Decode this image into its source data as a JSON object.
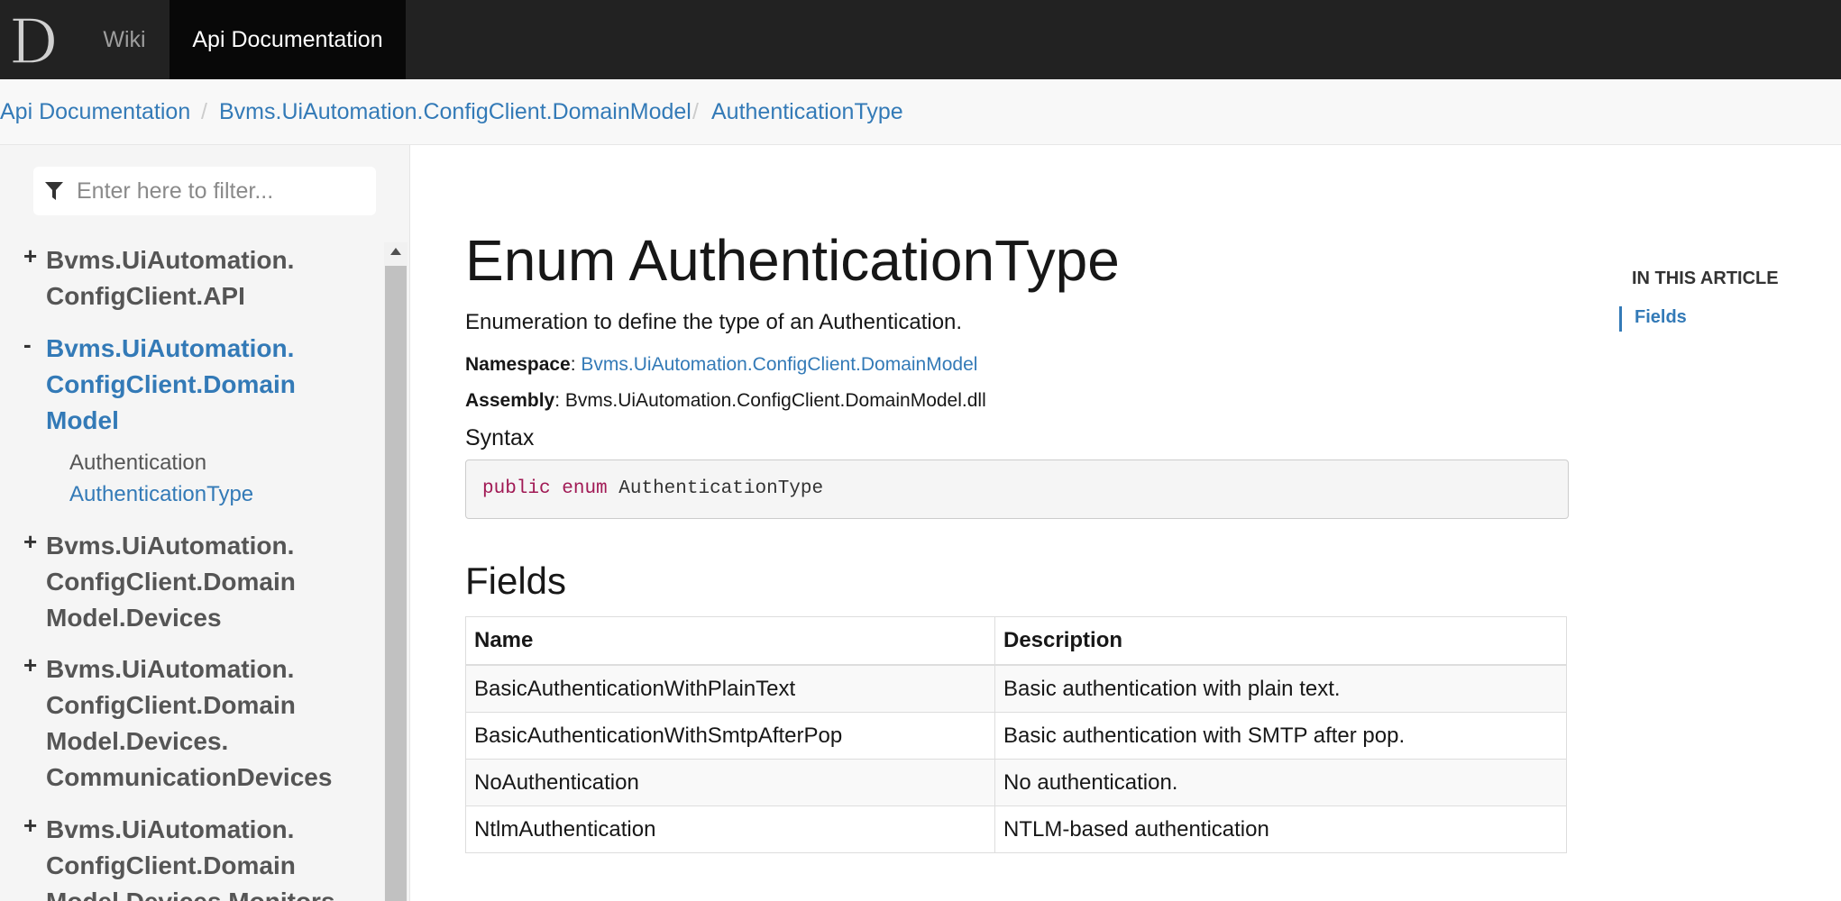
{
  "navbar": {
    "logo_letter": "D",
    "items": [
      {
        "label": "Wiki"
      },
      {
        "label": "Api Documentation"
      }
    ]
  },
  "breadcrumb": {
    "items": [
      {
        "label": "Api Documentation"
      },
      {
        "label": "Bvms.UiAutomation.ConfigClient.DomainModel"
      },
      {
        "label": "AuthenticationType"
      }
    ],
    "separator": "/"
  },
  "sidebar": {
    "filter_placeholder": "Enter here to filter...",
    "toc": [
      {
        "toggle": "+",
        "line1": "Bvms.UiAutomation.",
        "line2": "ConfigClient.API"
      },
      {
        "toggle": "-",
        "line1": "Bvms.UiAutomation.",
        "line2": "ConfigClient.Domain",
        "line3": "Model",
        "children": [
          {
            "label": "Authentication"
          },
          {
            "label": "AuthenticationType"
          }
        ]
      },
      {
        "toggle": "+",
        "line1": "Bvms.UiAutomation.",
        "line2": "ConfigClient.Domain",
        "line3": "Model.Devices"
      },
      {
        "toggle": "+",
        "line1": "Bvms.UiAutomation.",
        "line2": "ConfigClient.Domain",
        "line3": "Model.Devices.",
        "line4": "CommunicationDevices"
      },
      {
        "toggle": "+",
        "line1": "Bvms.UiAutomation.",
        "line2": "ConfigClient.Domain",
        "line3": "Model.Devices.Monitors"
      }
    ]
  },
  "article": {
    "title": "Enum AuthenticationType",
    "summary": "Enumeration to define the type of an Authentication.",
    "namespace_label": "Namespace",
    "namespace_value": "Bvms.UiAutomation.ConfigClient.DomainModel",
    "assembly_label": "Assembly",
    "assembly_value": "Bvms.UiAutomation.ConfigClient.DomainModel.dll",
    "syntax_heading": "Syntax",
    "code": {
      "kw1": "public",
      "kw2": "enum",
      "name": "AuthenticationType"
    },
    "fields_heading": "Fields",
    "table": {
      "headers": [
        "Name",
        "Description"
      ],
      "rows": [
        [
          "BasicAuthenticationWithPlainText",
          "Basic authentication with plain text."
        ],
        [
          "BasicAuthenticationWithSmtpAfterPop",
          "Basic authentication with SMTP after pop."
        ],
        [
          "NoAuthentication",
          "No authentication."
        ],
        [
          "NtlmAuthentication",
          "NTLM-based authentication"
        ]
      ]
    }
  },
  "affix": {
    "title": "IN THIS ARTICLE",
    "links": [
      {
        "label": "Fields"
      }
    ]
  },
  "colors": {
    "navbar_bg": "#222222",
    "link": "#337ab7",
    "keyword": "#a11a55"
  }
}
